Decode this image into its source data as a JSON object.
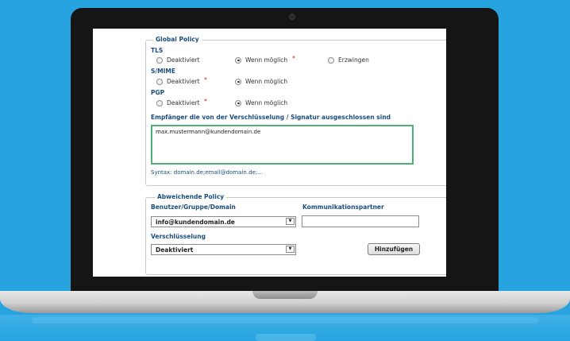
{
  "global_policy": {
    "legend": "Global Policy",
    "tls": {
      "label": "TLS",
      "options": [
        "Deaktiviert",
        "Wenn möglich",
        "Erzwingen"
      ],
      "selected": "Wenn möglich"
    },
    "smime": {
      "label": "S/MIME",
      "options": [
        "Deaktiviert",
        "Wenn möglich"
      ],
      "selected": "Wenn möglich"
    },
    "pgp": {
      "label": "PGP",
      "options": [
        "Deaktiviert",
        "Wenn möglich"
      ],
      "selected": "Wenn möglich"
    },
    "required_mark": "*",
    "exclusions_label": "Empfänger die von der Verschlüsselung / Signatur ausgeschlossen sind",
    "exclusions_value": "max.mustermann@kundendomain.de",
    "syntax": "Syntax: domain.de;email@domain.de;..."
  },
  "abweichende_policy": {
    "legend": "Abweichende Policy",
    "user_label": "Benutzer/Gruppe/Domain",
    "user_value": "info@kundendomain.de",
    "partner_label": "Kommunikationspartner",
    "partner_value": "",
    "encryption_label": "Verschlüsselung",
    "encryption_value": "Deaktiviert",
    "dropdown_glyph": "▼",
    "add_button": "Hinzufügen"
  },
  "colors": {
    "background": "#27a4e0",
    "label": "#1a4d7c",
    "focus_border": "#4bb273",
    "required": "#e02020"
  }
}
